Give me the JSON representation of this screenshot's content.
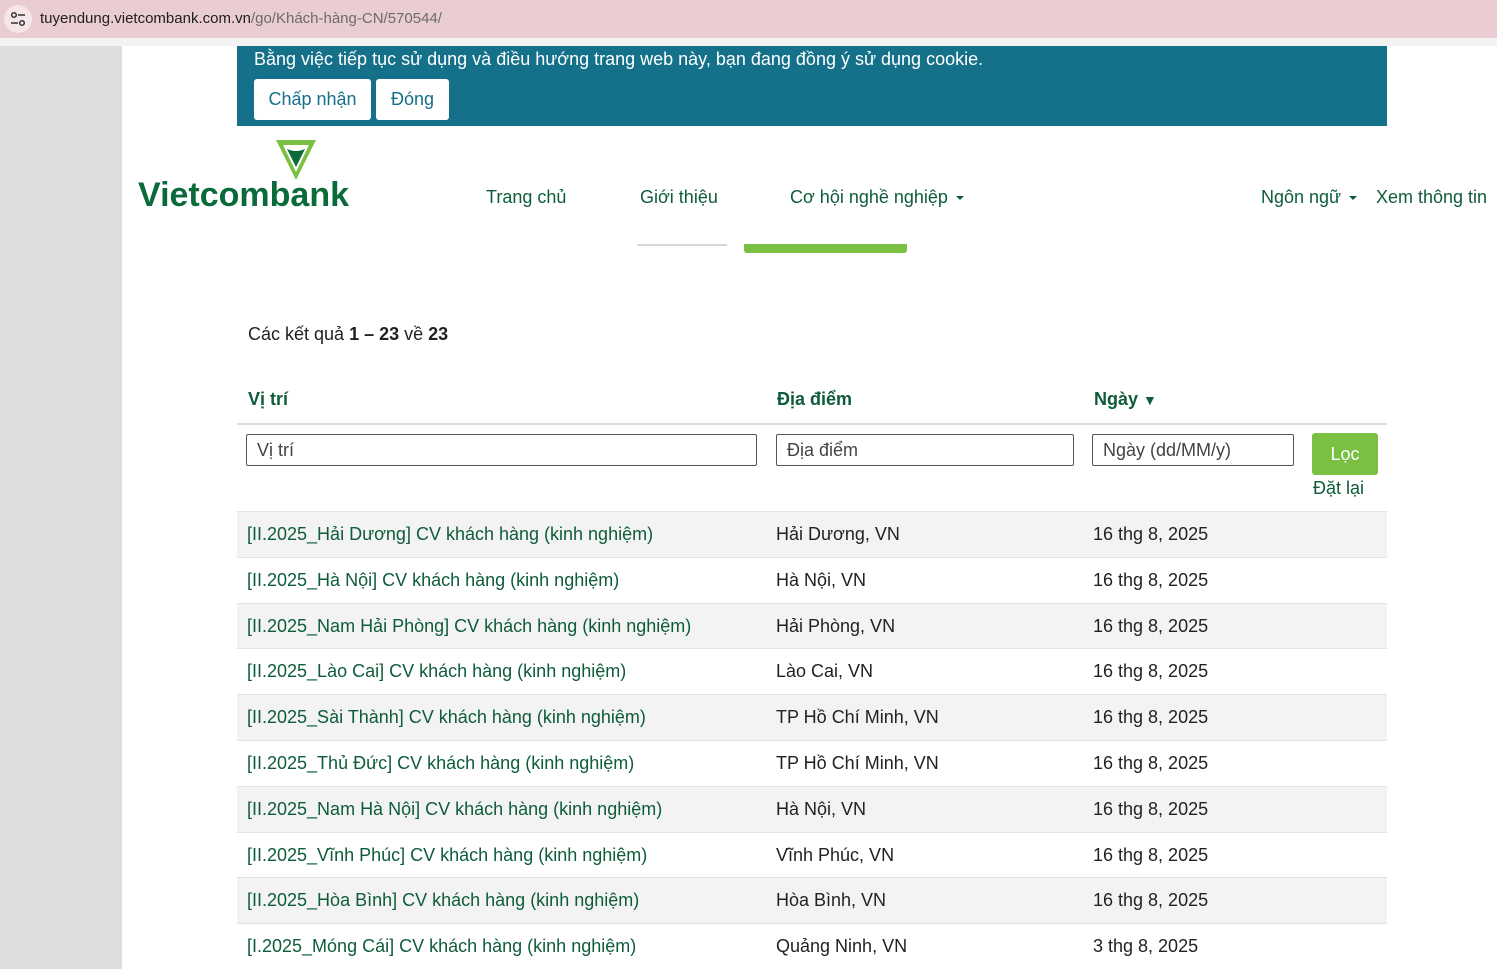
{
  "browser": {
    "url_host": "tuyendung.vietcombank.com.vn",
    "url_path": "/go/Khách-hàng-CN/570544/"
  },
  "cookie_banner": {
    "message": "Bằng việc tiếp tục sử dụng và điều hướng trang web này, bạn đang đồng ý sử dụng cookie.",
    "accept_label": "Chấp nhận",
    "close_label": "Đóng"
  },
  "brand": {
    "name": "Vietcombank",
    "color": "#0b6a3a"
  },
  "nav": {
    "home": "Trang chủ",
    "about": "Giới thiệu",
    "careers": "Cơ hội nghề nghiệp",
    "language": "Ngôn ngữ",
    "view_info": "Xem thông tin"
  },
  "results": {
    "prefix": "Các kết quả",
    "range": "1 – 23",
    "of": "về",
    "total": "23"
  },
  "table": {
    "headers": {
      "position": "Vị trí",
      "location": "Địa điểm",
      "date": "Ngày"
    },
    "filters": {
      "position_placeholder": "Vị trí",
      "location_placeholder": "Địa điểm",
      "date_placeholder": "Ngày (dd/MM/y)",
      "filter_label": "Lọc",
      "reset_label": "Đặt lại"
    },
    "rows": [
      {
        "title": "[II.2025_Hải Dương] CV khách hàng (kinh nghiệm)",
        "location": "Hải Dương, VN",
        "date": "16 thg 8, 2025"
      },
      {
        "title": "[II.2025_Hà Nội] CV khách hàng (kinh nghiệm)",
        "location": "Hà Nội, VN",
        "date": "16 thg 8, 2025"
      },
      {
        "title": "[II.2025_Nam Hải Phòng] CV khách hàng (kinh nghiệm)",
        "location": "Hải Phòng, VN",
        "date": "16 thg 8, 2025"
      },
      {
        "title": "[II.2025_Lào Cai] CV khách hàng (kinh nghiệm)",
        "location": "Lào Cai, VN",
        "date": "16 thg 8, 2025"
      },
      {
        "title": "[II.2025_Sài Thành] CV khách hàng (kinh nghiệm)",
        "location": "TP Hồ Chí Minh, VN",
        "date": "16 thg 8, 2025"
      },
      {
        "title": "[II.2025_Thủ Đức] CV khách hàng (kinh nghiệm)",
        "location": "TP Hồ Chí Minh, VN",
        "date": "16 thg 8, 2025"
      },
      {
        "title": "[II.2025_Nam Hà Nội] CV khách hàng (kinh nghiệm)",
        "location": "Hà Nội, VN",
        "date": "16 thg 8, 2025"
      },
      {
        "title": "[II.2025_Vĩnh Phúc] CV khách hàng (kinh nghiệm)",
        "location": "Vĩnh Phúc, VN",
        "date": "16 thg 8, 2025"
      },
      {
        "title": "[II.2025_Hòa Bình] CV khách hàng (kinh nghiệm)",
        "location": "Hòa Bình, VN",
        "date": "16 thg 8, 2025"
      },
      {
        "title": "[I.2025_Móng Cái] CV khách hàng (kinh nghiệm)",
        "location": "Quảng Ninh, VN",
        "date": "3 thg 8, 2025"
      }
    ]
  },
  "colors": {
    "cookie_bg": "#15708a",
    "accent_green": "#7ac143",
    "link_green": "#0e5c3a"
  }
}
